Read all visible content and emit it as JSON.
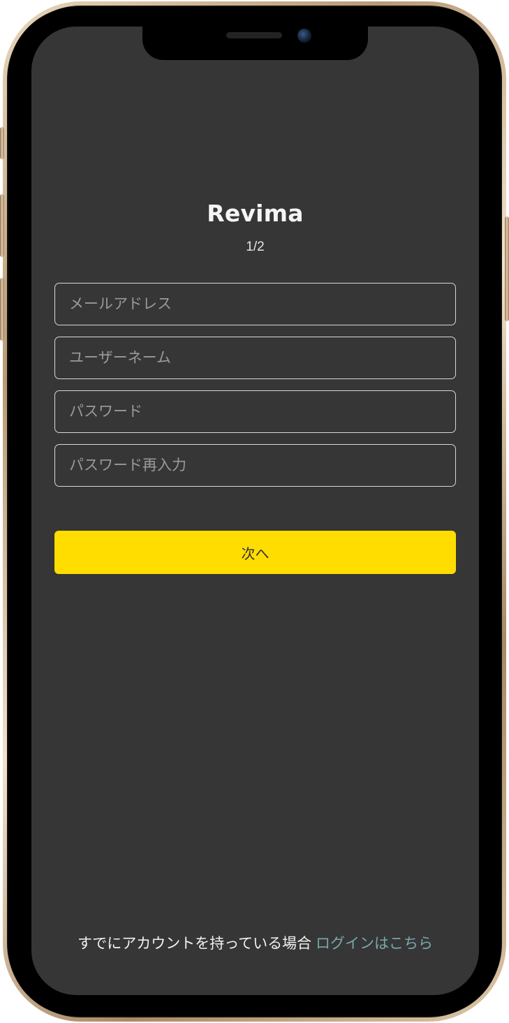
{
  "app": {
    "title": "Revima",
    "step": "1/2"
  },
  "form": {
    "email_placeholder": "メールアドレス",
    "username_placeholder": "ユーザーネーム",
    "password_placeholder": "パスワード",
    "password_confirm_placeholder": "パスワード再入力",
    "next_label": "次へ"
  },
  "footer": {
    "text": "すでにアカウントを持っている場合",
    "login_link": "ログインはこちら"
  },
  "colors": {
    "background": "#363636",
    "primary_button": "#ffdd00",
    "link": "#79a8ae"
  }
}
